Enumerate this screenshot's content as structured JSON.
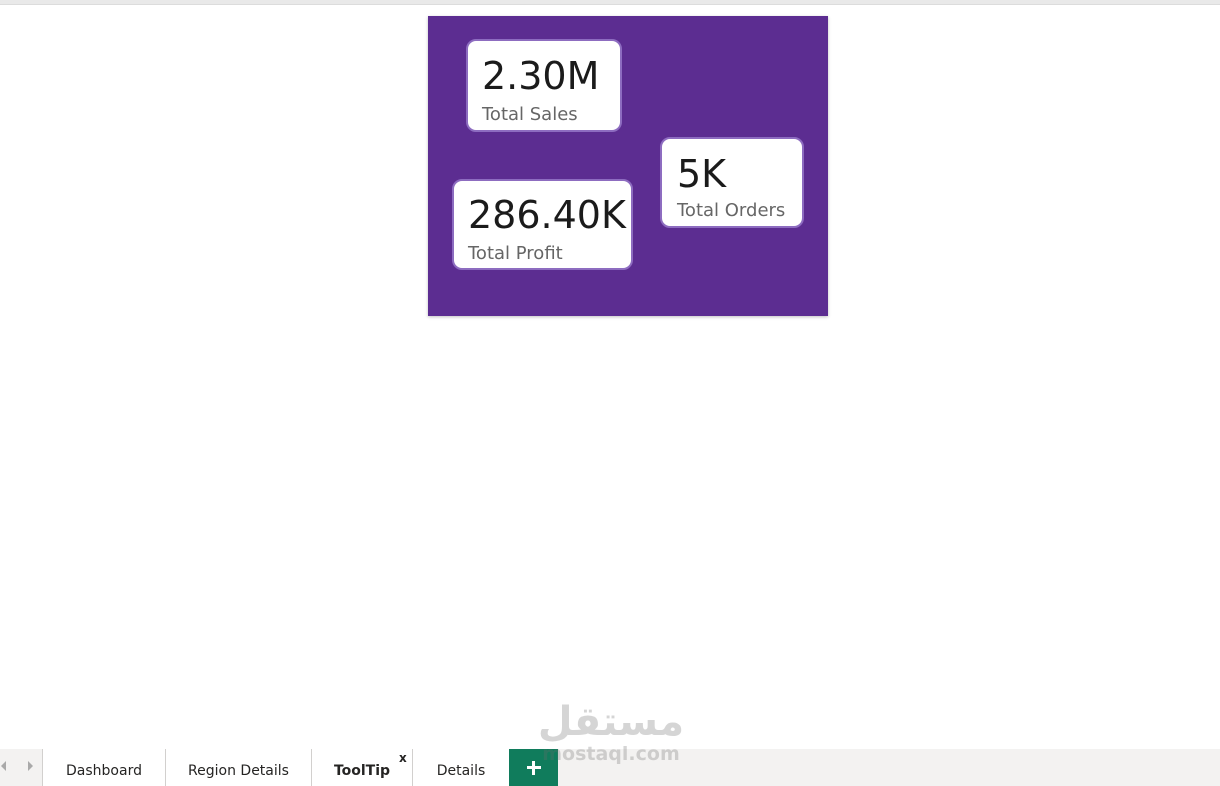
{
  "kpi_cards": {
    "sales": {
      "value": "2.30M",
      "label": "Total Sales"
    },
    "orders": {
      "value": "5K",
      "label": "Total Orders"
    },
    "profit": {
      "value": "286.40K",
      "label": "Total Profit"
    }
  },
  "page_tabs": {
    "items": [
      {
        "label": "Dashboard"
      },
      {
        "label": "Region Details"
      },
      {
        "label": "ToolTip",
        "close": "x"
      },
      {
        "label": "Details"
      }
    ],
    "add_icon": "plus-icon",
    "nav_icons": [
      "chevron-left-icon",
      "chevron-right-icon"
    ]
  },
  "watermark": {
    "brand": "مستقل",
    "domain": "mostaql.com"
  },
  "colors": {
    "canvas_background": "#5c2d91",
    "card_border": "#8d6cc0",
    "add_page_button": "#107c5c"
  }
}
